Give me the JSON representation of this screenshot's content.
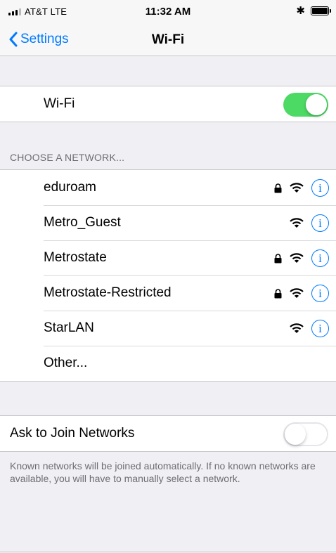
{
  "status_bar": {
    "carrier": "AT&T  LTE",
    "time": "11:32 AM",
    "bluetooth_glyph": "✱"
  },
  "nav": {
    "back_label": "Settings",
    "title": "Wi-Fi"
  },
  "wifi": {
    "label": "Wi-Fi",
    "enabled": true
  },
  "network_section": {
    "header": "CHOOSE A NETWORK..."
  },
  "networks": [
    {
      "name": "eduroam",
      "locked": true,
      "icons": [
        "lock-icon",
        "wifi-signal-icon",
        "info-icon"
      ]
    },
    {
      "name": "Metro_Guest",
      "locked": false,
      "icons": [
        "wifi-signal-icon",
        "info-icon"
      ]
    },
    {
      "name": "Metrostate",
      "locked": true,
      "icons": [
        "lock-icon",
        "wifi-signal-icon",
        "info-icon"
      ]
    },
    {
      "name": "Metrostate-Restricted",
      "locked": true,
      "icons": [
        "lock-icon",
        "wifi-signal-icon",
        "info-icon"
      ]
    },
    {
      "name": "StarLAN",
      "locked": false,
      "icons": [
        "wifi-signal-icon",
        "info-icon"
      ]
    }
  ],
  "other_label": "Other...",
  "ask_to_join": {
    "label": "Ask to Join Networks",
    "enabled": false,
    "footer": "Known networks will be joined automatically. If no known networks are available, you will have to manually select a network."
  },
  "info_glyph": "i",
  "colors": {
    "accent": "#007aff",
    "toggle_on": "#4cd964",
    "background": "#efeff4"
  }
}
